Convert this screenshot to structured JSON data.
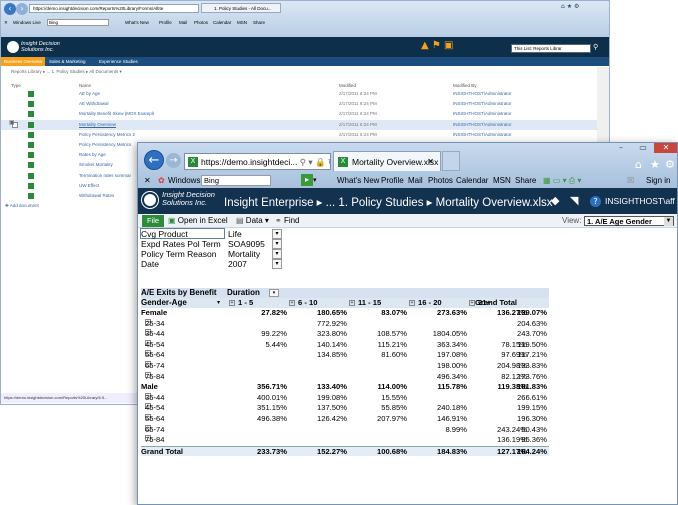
{
  "back_window": {
    "address": "https://demo.insightdecision.com/Reports%20Library/Forms/AllIte",
    "tab_label": "1. Policy Studies - All Docu...",
    "favorites": {
      "windows_live": "Windows Live",
      "bing": "Bing",
      "links": [
        "What's New",
        "Profile",
        "Mail",
        "Photos",
        "Calendar",
        "MSN",
        "Share"
      ]
    },
    "brand_line1": "Insight Decision",
    "brand_line2": "Solutions Inc.",
    "search_placeholder": "This List: Reports Librar",
    "topnav": [
      "Business Overview",
      "Sales & Marketing",
      "Experience Studies"
    ],
    "breadcrumb": "Reports Library ▸ ... 1. Policy Studies ▸ All Documents ▾",
    "columns": {
      "type": "Type",
      "name": "Name",
      "modified": "Modified",
      "modified_by": "Modified By"
    },
    "rows": [
      {
        "name": "AE by Age",
        "modified": "2/17/2011 6:24 PM",
        "by": "INSIGHTHOST\\Administrator"
      },
      {
        "name": "AE Withdrawal",
        "modified": "2/17/2011 6:24 PM",
        "by": "INSIGHTHOST\\Administrator"
      },
      {
        "name": "Mortality Benefit Skew (MOX Example)",
        "modified": "2/17/2011 6:24 PM",
        "by": "INSIGHTHOST\\Administrator"
      },
      {
        "name": "Mortality Overview",
        "modified": "2/17/2011 6:24 PM",
        "by": "INSIGHTHOST\\Administrator"
      },
      {
        "name": "Policy Persistency Metrics 2",
        "modified": "2/17/2011 6:24 PM",
        "by": "INSIGHTHOST\\Administrator"
      },
      {
        "name": "Policy Persistency Metrics",
        "modified": "",
        "by": ""
      },
      {
        "name": "Rates by Age",
        "modified": "",
        "by": ""
      },
      {
        "name": "Smoker Mortality",
        "modified": "",
        "by": ""
      },
      {
        "name": "Termination rates summar",
        "modified": "",
        "by": ""
      },
      {
        "name": "UW Effect",
        "modified": "",
        "by": ""
      },
      {
        "name": "Withdrawal Rates",
        "modified": "",
        "by": ""
      }
    ],
    "add_document": "Add document",
    "status_url": "https://demo.insightdecision.com/Reports%20Library/6.5..."
  },
  "front_window": {
    "address": "https://demo.insightdeci... ",
    "tab_label": "Mortality Overview.xlsx",
    "favorites": {
      "windows_live": "Windows Live",
      "bing": "Bing",
      "links": [
        "What's New",
        "Profile",
        "Mail",
        "Photos",
        "Calendar",
        "MSN",
        "Share"
      ],
      "sign_in": "Sign in"
    },
    "brand_line1": "Insight Decision",
    "brand_line2": "Solutions Inc.",
    "app_title": "Insight Enterprise ▸ ... 1. Policy Studies ▸ Mortality Overview.xlsx",
    "user": "INSIGHTHOST\\aff ▾",
    "toolbar": {
      "file": "File",
      "open_excel": "Open in Excel",
      "data": "Data ▾",
      "find": "Find",
      "view_label": "View:",
      "view_value": "1. A/E Age Gender"
    },
    "filters": [
      {
        "key": "Cvg Product",
        "value": "Life"
      },
      {
        "key": "Expd Rates Pol Term",
        "value": "SOA9095"
      },
      {
        "key": "Policy Term Reason",
        "value": "Mortality"
      },
      {
        "key": "Date",
        "value": "2007"
      }
    ],
    "pivot": {
      "measure": "A/E Exits by Benefit",
      "col_field": "Duration",
      "row_field": "Gender-Age",
      "col_headers": [
        "1 - 5",
        "6 - 10",
        "11 - 15",
        "16 - 20",
        "21+",
        "Grand Total"
      ],
      "rows": [
        {
          "label": "Female",
          "level": 0,
          "vals": [
            "27.82%",
            "180.65%",
            "83.07%",
            "273.63%",
            "136.27%",
            "139.07%"
          ]
        },
        {
          "label": "25-34",
          "level": 1,
          "vals": [
            "",
            "772.92%",
            "",
            "",
            "",
            "204.63%"
          ]
        },
        {
          "label": "35-44",
          "level": 1,
          "vals": [
            "99.22%",
            "323.80%",
            "108.57%",
            "1804.05%",
            "",
            "243.70%"
          ]
        },
        {
          "label": "45-54",
          "level": 1,
          "vals": [
            "5.44%",
            "140.14%",
            "115.21%",
            "363.34%",
            "78.15%",
            "119.50%"
          ]
        },
        {
          "label": "55-64",
          "level": 1,
          "vals": [
            "",
            "134.85%",
            "81.60%",
            "197.08%",
            "97.69%",
            "117.21%"
          ]
        },
        {
          "label": "65-74",
          "level": 1,
          "vals": [
            "",
            "",
            "",
            "198.00%",
            "204.98%",
            "133.83%"
          ]
        },
        {
          "label": "75-84",
          "level": 1,
          "vals": [
            "",
            "",
            "",
            "496.34%",
            "82.12%",
            "173.76%"
          ]
        },
        {
          "label": "Male",
          "level": 0,
          "vals": [
            "356.71%",
            "133.40%",
            "114.00%",
            "115.78%",
            "119.38%",
            "181.83%"
          ]
        },
        {
          "label": "35-44",
          "level": 1,
          "vals": [
            "400.01%",
            "199.08%",
            "15.55%",
            "",
            "",
            "266.61%"
          ]
        },
        {
          "label": "45-54",
          "level": 1,
          "vals": [
            "351.15%",
            "137.50%",
            "55.85%",
            "240.18%",
            "",
            "199.15%"
          ]
        },
        {
          "label": "55-64",
          "level": 1,
          "vals": [
            "496.38%",
            "126.42%",
            "207.97%",
            "146.91%",
            "",
            "196.30%"
          ]
        },
        {
          "label": "65-74",
          "level": 1,
          "vals": [
            "",
            "",
            "",
            "8.99%",
            "243.24%",
            "50.43%"
          ]
        },
        {
          "label": "75-84",
          "level": 1,
          "vals": [
            "",
            "",
            "",
            "",
            "136.19%",
            "95.36%"
          ]
        },
        {
          "label": "Grand Total",
          "level": 0,
          "vals": [
            "233.73%",
            "152.27%",
            "100.68%",
            "184.83%",
            "127.17%",
            "164.24%"
          ]
        }
      ]
    }
  }
}
